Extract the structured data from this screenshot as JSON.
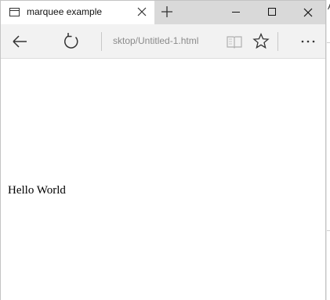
{
  "window": {
    "tab_title": "marquee example",
    "address": "sktop/Untitled-1.html"
  },
  "icons": {
    "tab": "page-icon",
    "tab_close": "close-icon",
    "new_tab": "plus-icon",
    "minimize": "minimize-icon",
    "maximize": "maximize-icon",
    "close": "close-icon",
    "back": "back-arrow-icon",
    "refresh": "refresh-icon",
    "reading_view": "book-icon",
    "favorite": "star-icon",
    "more": "ellipsis-icon"
  },
  "content": {
    "marquee_text": "Hello World"
  },
  "background": {
    "right_fragment": "A"
  }
}
